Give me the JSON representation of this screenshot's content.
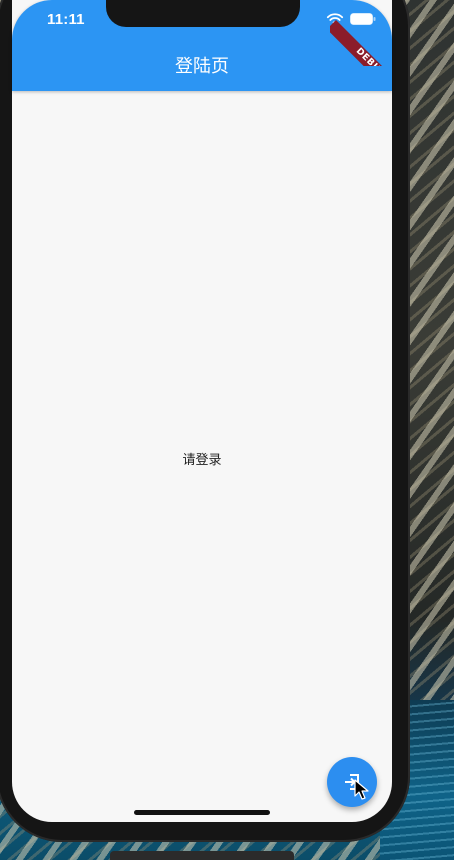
{
  "status_bar": {
    "time": "11:11",
    "icons": [
      "wifi-icon",
      "battery-icon"
    ]
  },
  "app_bar": {
    "title": "登陆页",
    "color": "#2c95f3"
  },
  "debug_banner": {
    "label": "DEBUG",
    "color": "#8b1c2a"
  },
  "body": {
    "message": "请登录",
    "background": "#f7f7f7"
  },
  "fab": {
    "icon": "login-icon",
    "color": "#2c8ef0"
  }
}
